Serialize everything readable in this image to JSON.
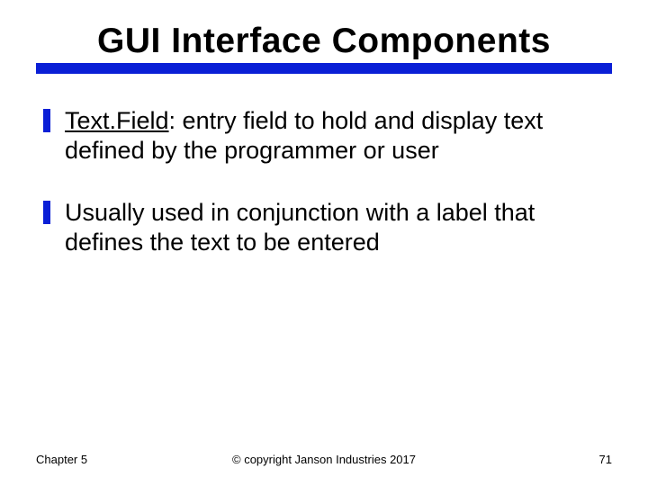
{
  "title": "GUI Interface Components",
  "bullets": [
    {
      "term": "Text.Field",
      "rest": ": entry field to hold and display text defined by the programmer or user"
    },
    {
      "text": "Usually used in conjunction with a label that defines the text to be entered"
    }
  ],
  "footer": {
    "left": "Chapter 5",
    "center": "© copyright Janson Industries 2017",
    "right": "71"
  }
}
